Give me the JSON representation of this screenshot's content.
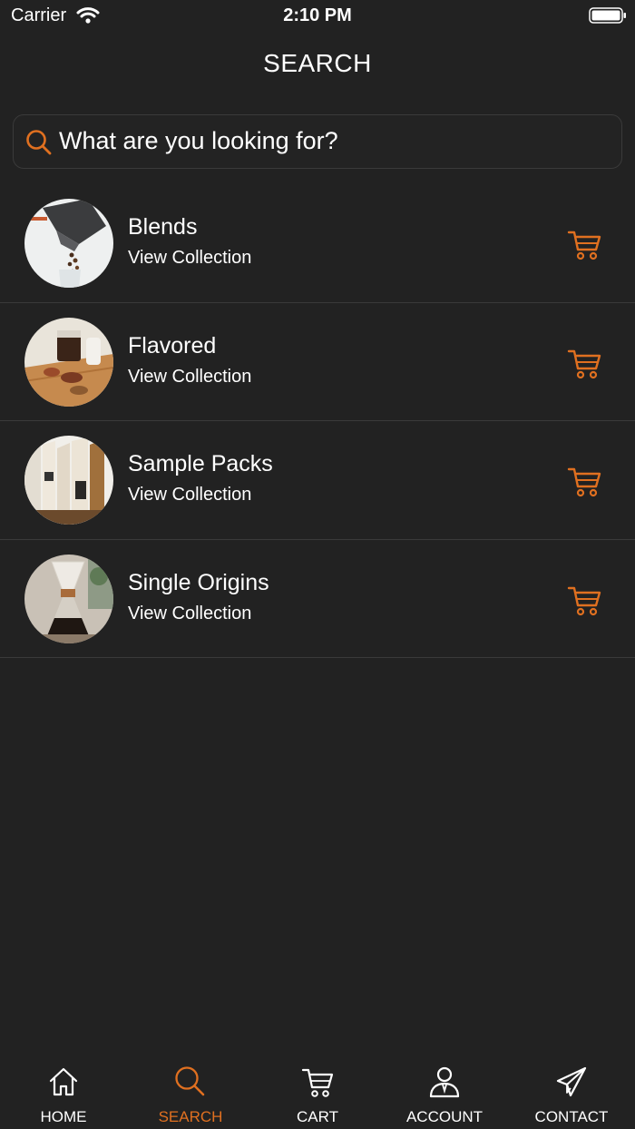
{
  "status_bar": {
    "carrier": "Carrier",
    "time": "2:10 PM"
  },
  "nav": {
    "title": "SEARCH"
  },
  "search": {
    "placeholder": "What are you looking for?",
    "value": ""
  },
  "collections": [
    {
      "title": "Blends",
      "subtitle": "View Collection",
      "thumb_icon": "coffee-beans-pouring-photo"
    },
    {
      "title": "Flavored",
      "subtitle": "View Collection",
      "thumb_icon": "coffee-cups-on-table-photo"
    },
    {
      "title": "Sample Packs",
      "subtitle": "View Collection",
      "thumb_icon": "coffee-bags-on-shelf-photo"
    },
    {
      "title": "Single Origins",
      "subtitle": "View Collection",
      "thumb_icon": "chemex-coffee-maker-photo"
    }
  ],
  "tab_bar": {
    "items": [
      {
        "label": "HOME",
        "icon": "home-icon",
        "active": false
      },
      {
        "label": "SEARCH",
        "icon": "search-icon",
        "active": true
      },
      {
        "label": "CART",
        "icon": "cart-icon",
        "active": false
      },
      {
        "label": "ACCOUNT",
        "icon": "account-icon",
        "active": false
      },
      {
        "label": "CONTACT",
        "icon": "paper-plane-icon",
        "active": false
      }
    ]
  },
  "colors": {
    "background": "#222222",
    "accent": "#e07020",
    "divider": "#3a3a3a",
    "text": "#ffffff"
  }
}
